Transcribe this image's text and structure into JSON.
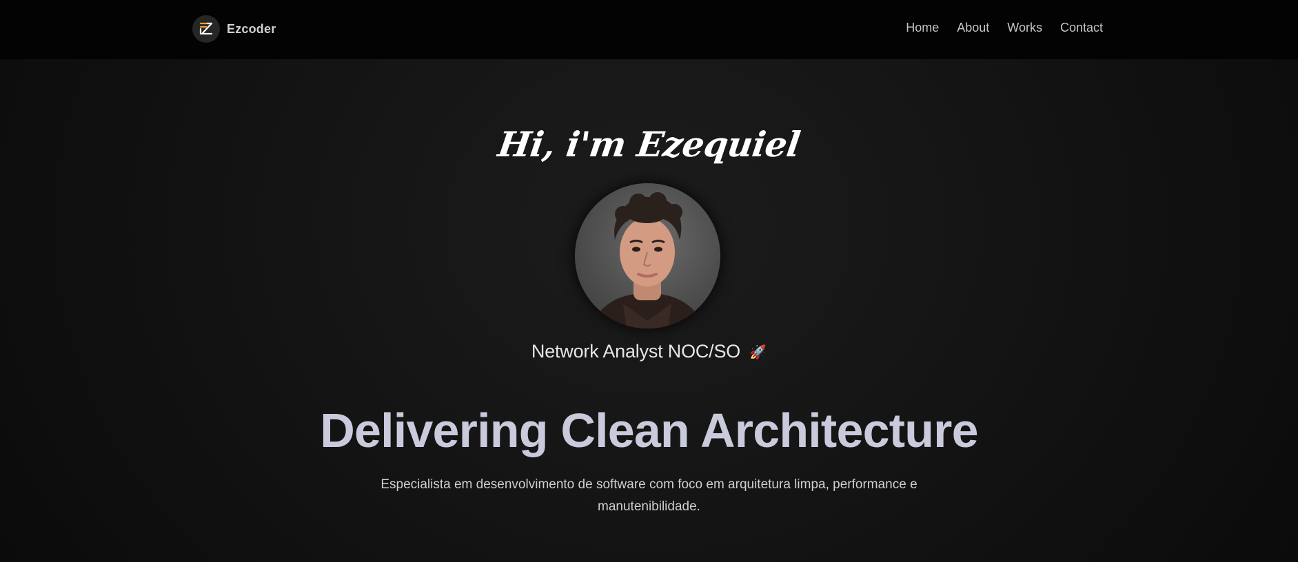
{
  "nav": {
    "brand": "Ezcoder",
    "links": [
      "Home",
      "About",
      "Works",
      "Contact"
    ]
  },
  "hero": {
    "greeting": "Hi, i'm Ezequiel",
    "role": "Network Analyst NOC/SO",
    "role_emoji": "🚀",
    "headline": "Delivering Clean Architecture",
    "subtitle": "Especialista em desenvolvimento de software com foco em arquitetura limpa, performance e manutenibilidade."
  },
  "icons": {
    "logo": "ez-logo-icon",
    "avatar": "profile-photo"
  },
  "colors": {
    "background": "#0c0c0c",
    "navbar": "#030303",
    "headline": "#c9cadb",
    "logo_accent": "#f0a030"
  }
}
